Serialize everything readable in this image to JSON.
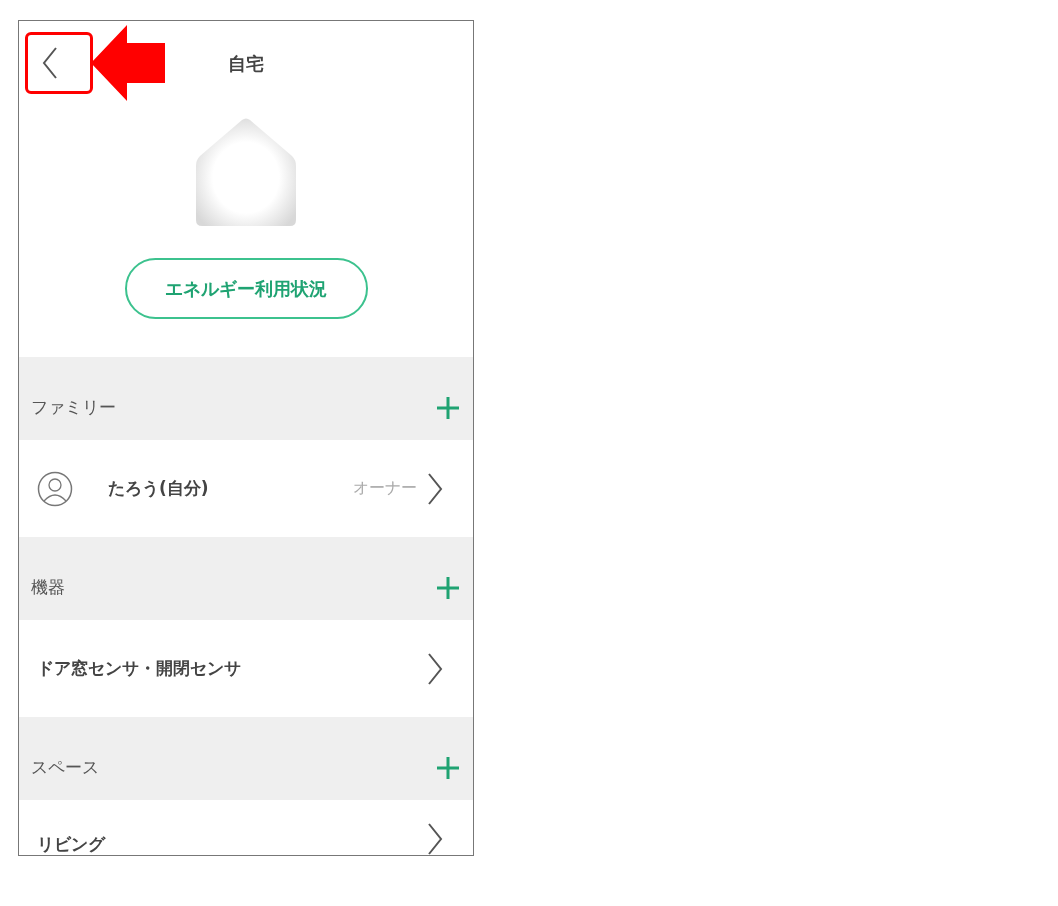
{
  "header": {
    "title": "自宅",
    "back": {
      "highlighted": true
    }
  },
  "home": {
    "energy_button": "エネルギー利用状況"
  },
  "sections": [
    {
      "title": "ファミリー",
      "items": [
        {
          "kind": "person",
          "label": "たろう(自分)",
          "role": "オーナー"
        }
      ]
    },
    {
      "title": "機器",
      "items": [
        {
          "kind": "plain",
          "label": "ドア窓センサ・開閉センサ"
        }
      ]
    },
    {
      "title": "スペース",
      "items": [
        {
          "kind": "plain",
          "label": "リビング"
        }
      ]
    }
  ]
}
